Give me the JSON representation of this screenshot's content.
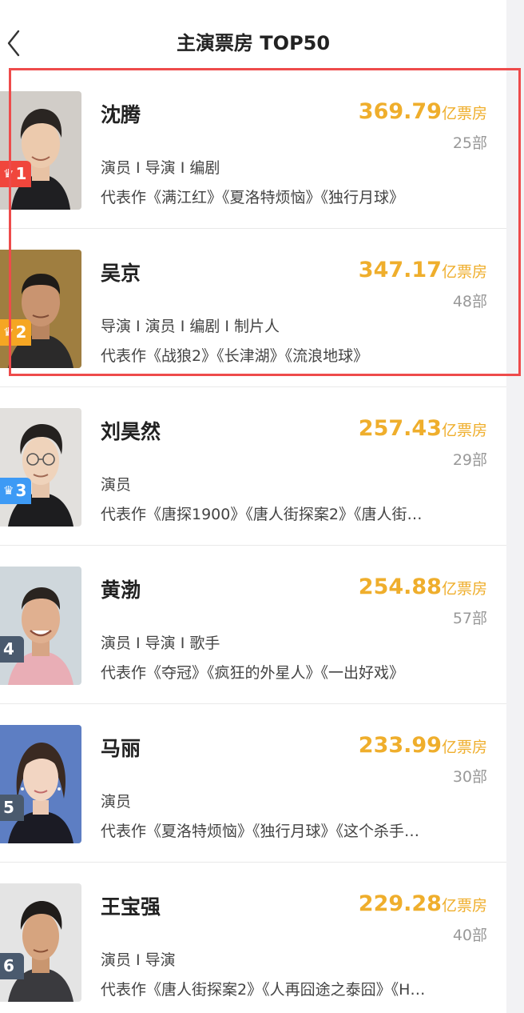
{
  "header": {
    "title": "主演票房 TOP50",
    "back_icon": "chevron-left-icon"
  },
  "colors": {
    "accent": "#efae2c",
    "highlight": "#ee4b4b",
    "rank1": "#f0463c",
    "rank2": "#f5a623",
    "rank3": "#3d9af5",
    "rankOther": "#4a5a6e"
  },
  "actors": [
    {
      "rank": "1",
      "name": "沈腾",
      "box_office": "369.79",
      "box_unit": "亿票房",
      "films": "25部",
      "roles": "演员 I 导演 I 编剧",
      "works": "代表作《满江红》《夏洛特烦恼》《独行月球》"
    },
    {
      "rank": "2",
      "name": "吴京",
      "box_office": "347.17",
      "box_unit": "亿票房",
      "films": "48部",
      "roles": "导演 I 演员 I 编剧 I 制片人",
      "works": "代表作《战狼2》《长津湖》《流浪地球》"
    },
    {
      "rank": "3",
      "name": "刘昊然",
      "box_office": "257.43",
      "box_unit": "亿票房",
      "films": "29部",
      "roles": "演员",
      "works": "代表作《唐探1900》《唐人街探案2》《唐人街…"
    },
    {
      "rank": "4",
      "name": "黄渤",
      "box_office": "254.88",
      "box_unit": "亿票房",
      "films": "57部",
      "roles": "演员 I 导演 I 歌手",
      "works": "代表作《夺冠》《疯狂的外星人》《一出好戏》"
    },
    {
      "rank": "5",
      "name": "马丽",
      "box_office": "233.99",
      "box_unit": "亿票房",
      "films": "30部",
      "roles": "演员",
      "works": "代表作《夏洛特烦恼》《独行月球》《这个杀手…"
    },
    {
      "rank": "6",
      "name": "王宝强",
      "box_office": "229.28",
      "box_unit": "亿票房",
      "films": "40部",
      "roles": "演员 I 导演",
      "works": "代表作《唐人街探案2》《人再囧途之泰囧》《H…"
    }
  ]
}
